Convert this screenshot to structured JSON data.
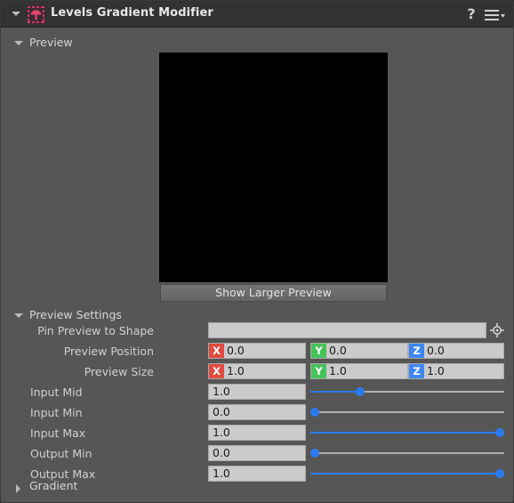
{
  "window": {
    "title": "Levels Gradient Modifier",
    "node_icon": "gradient-modifier-node-icon",
    "help_icon": "?",
    "menu_icon": "hamburger-menu-icon",
    "collapse_icon": "triangle-down-icon",
    "accent_color": "#d4386b",
    "titlebar_color": "#333333",
    "panel_color": "#565656"
  },
  "sections": {
    "preview": {
      "label": "Preview",
      "expanded": true,
      "arrow": "triangle-down-icon"
    },
    "preview_settings": {
      "label": "Preview Settings",
      "expanded": true,
      "arrow": "triangle-down-icon"
    },
    "gradient": {
      "label": "Gradient",
      "expanded": false,
      "arrow": "triangle-right-icon"
    }
  },
  "preview": {
    "image_color": "#000000",
    "show_larger_button": "Show Larger Preview"
  },
  "parameters": {
    "pin_preview_to_shape": {
      "label": "Pin Preview to Shape",
      "value": "",
      "placeholder": "",
      "picker_icon": "crosshair-target-icon"
    },
    "preview_position": {
      "label": "Preview Position",
      "components": [
        {
          "tag": "X",
          "value": "0.0",
          "color": "#e24b3f"
        },
        {
          "tag": "Y",
          "value": "0.0",
          "color": "#46c25a"
        },
        {
          "tag": "Z",
          "value": "0.0",
          "color": "#3d86f5"
        }
      ]
    },
    "preview_size": {
      "label": "Preview Size",
      "components": [
        {
          "tag": "X",
          "value": "1.0",
          "color": "#e24b3f"
        },
        {
          "tag": "Y",
          "value": "1.0",
          "color": "#46c25a"
        },
        {
          "tag": "Z",
          "value": "1.0",
          "color": "#3d86f5"
        }
      ]
    },
    "sliders": [
      {
        "label": "Input Mid",
        "value": "1.0",
        "fraction": 0.26
      },
      {
        "label": "Input Min",
        "value": "0.0",
        "fraction": 0.0
      },
      {
        "label": "Input Max",
        "value": "1.0",
        "fraction": 1.0
      },
      {
        "label": "Output Min",
        "value": "0.0",
        "fraction": 0.0
      },
      {
        "label": "Output Max",
        "value": "1.0",
        "fraction": 1.0
      }
    ],
    "slider_colors": {
      "track": "#b0b0b0",
      "fill": "#2a7bf0",
      "knob": "#2a7bf0"
    }
  }
}
